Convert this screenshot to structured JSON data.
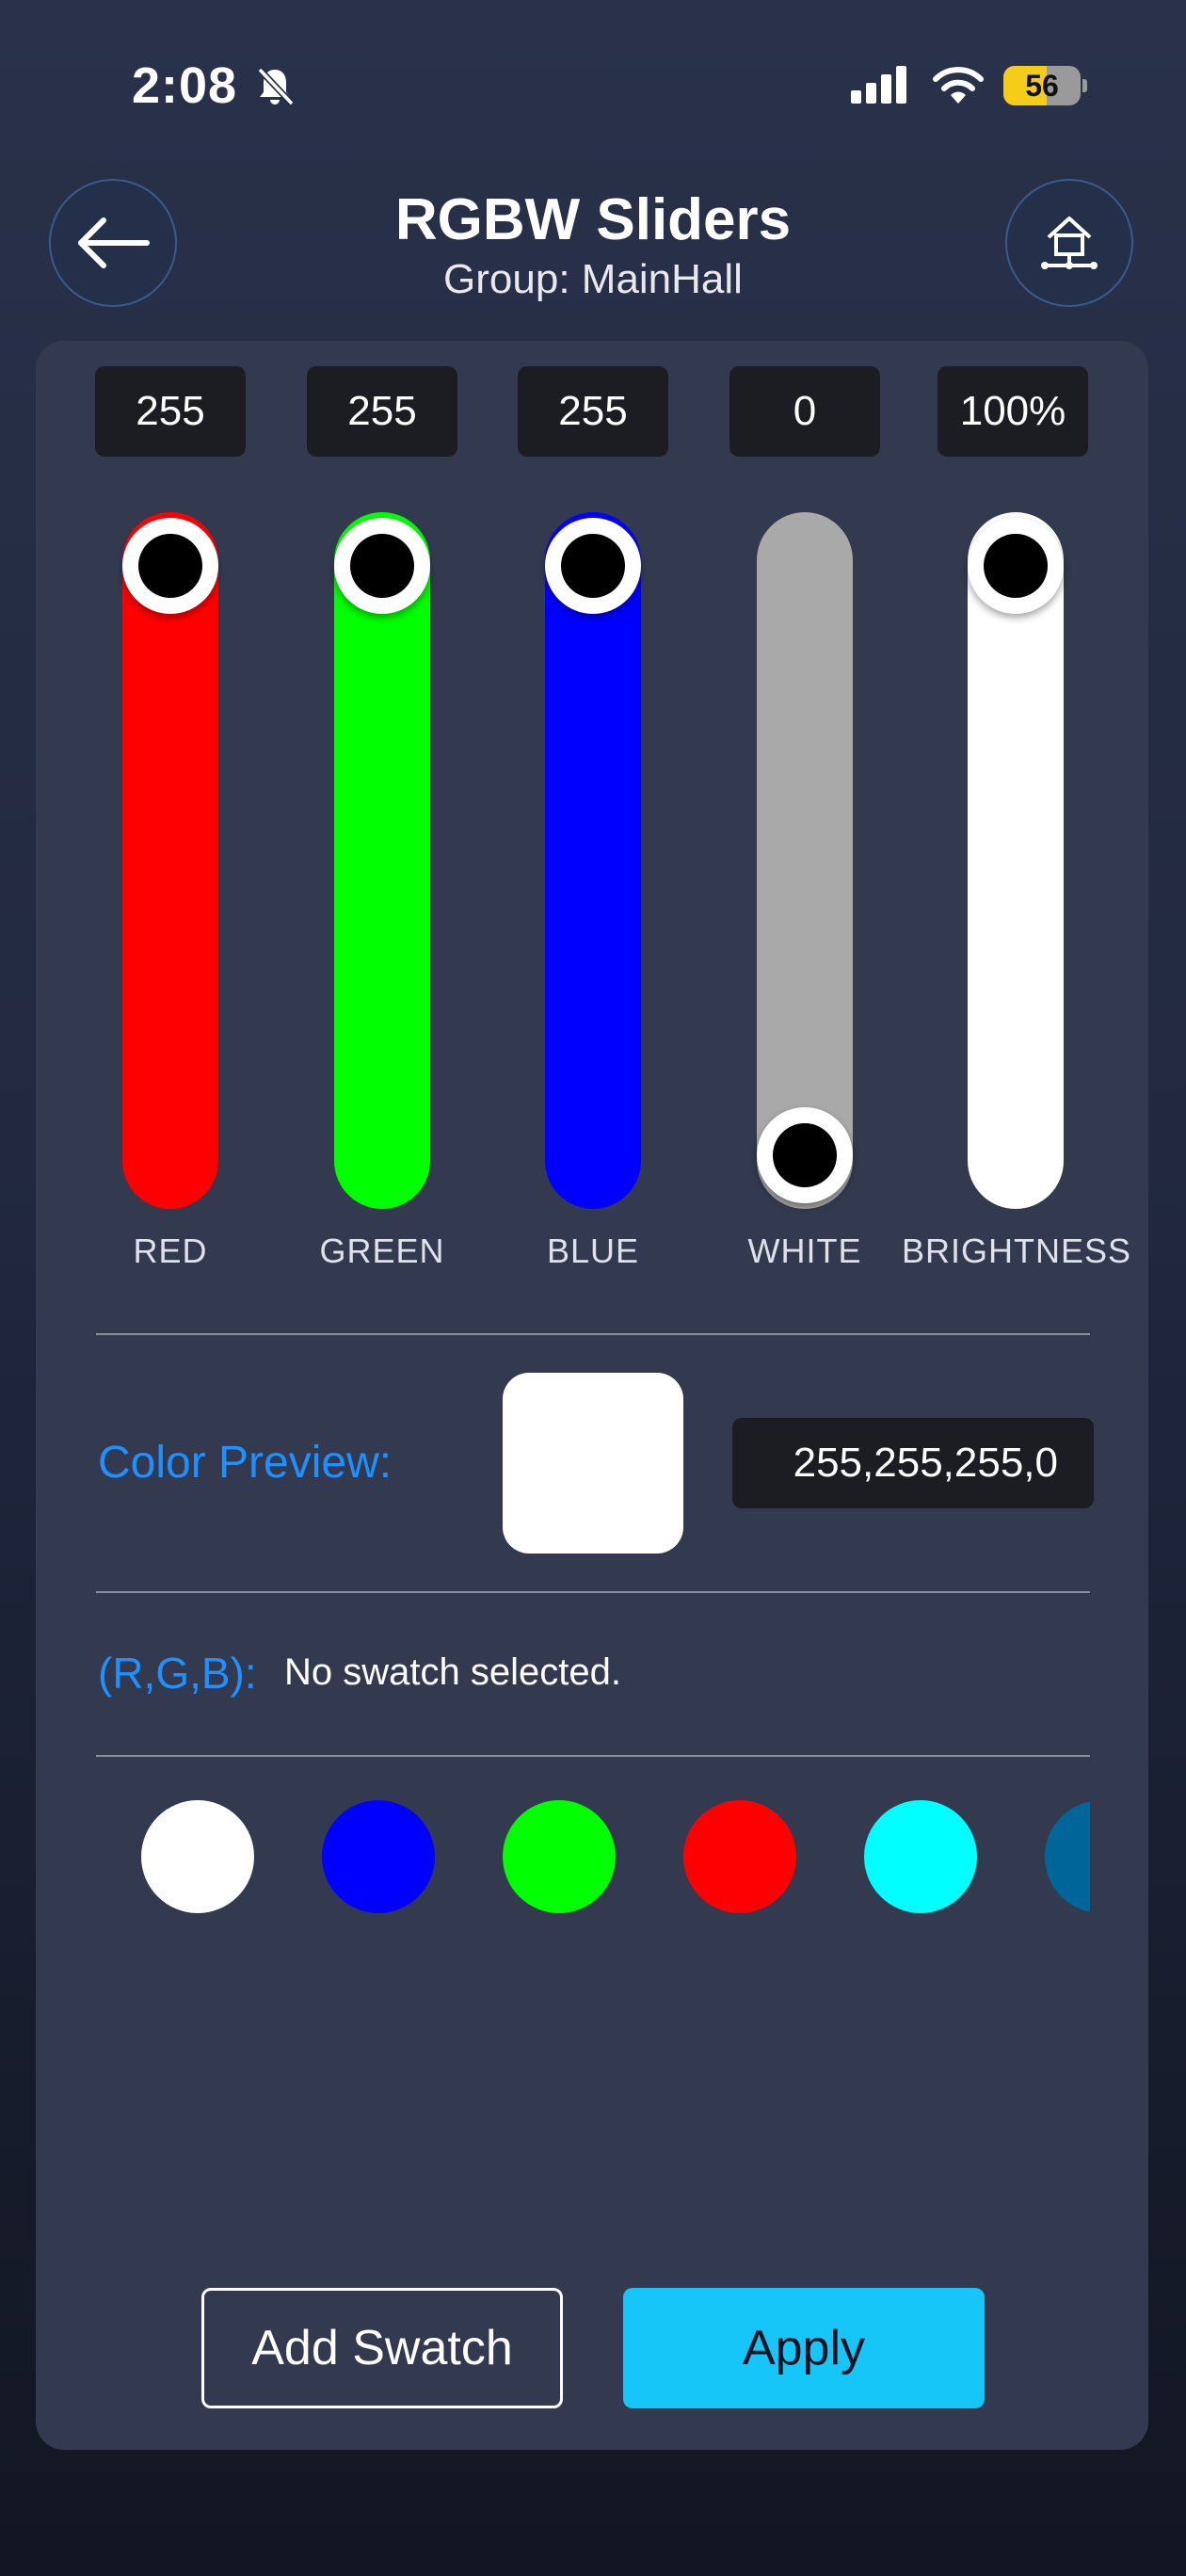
{
  "status_bar": {
    "time": "2:08",
    "battery": "56",
    "battery_level": 0.56
  },
  "header": {
    "title": "RGBW Sliders",
    "subtitle": "Group: MainHall"
  },
  "channels": [
    {
      "label": "RED",
      "value_text": "255",
      "value": 255,
      "max": 255,
      "color": "#ff0000"
    },
    {
      "label": "GREEN",
      "value_text": "255",
      "value": 255,
      "max": 255,
      "color": "#00ff00"
    },
    {
      "label": "BLUE",
      "value_text": "255",
      "value": 255,
      "max": 255,
      "color": "#0000ff"
    },
    {
      "label": "WHITE",
      "value_text": "0",
      "value": 0,
      "max": 255,
      "color": "#a9a9a9"
    },
    {
      "label": "BRIGHTNESS",
      "value_text": "100%",
      "value": 100,
      "max": 100,
      "color": "#ffffff"
    }
  ],
  "preview": {
    "label": "Color Preview:",
    "value": "255,255,255,0",
    "color": "#ffffff"
  },
  "rgb": {
    "label": "(R,G,B):",
    "status": "No swatch selected."
  },
  "swatches": [
    "#ffffff",
    "#0000ff",
    "#00ff00",
    "#ff0000",
    "#00ffff",
    "#006699"
  ],
  "actions": {
    "add_swatch": "Add Swatch",
    "apply": "Apply"
  }
}
